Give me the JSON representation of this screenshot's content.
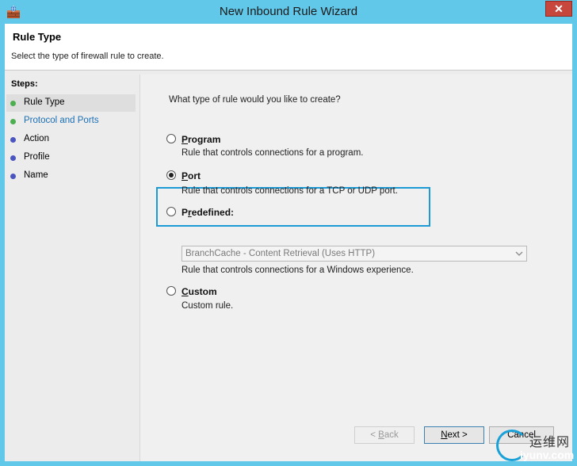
{
  "window": {
    "title": "New Inbound Rule Wizard",
    "close_glyph": "✕"
  },
  "header": {
    "title": "Rule Type",
    "description": "Select the type of firewall rule to create."
  },
  "steps": {
    "label": "Steps:",
    "items": [
      {
        "label": "Rule Type",
        "color": "#4caf50",
        "current": true
      },
      {
        "label": "Protocol and Ports",
        "color": "#4caf50",
        "link": true
      },
      {
        "label": "Action",
        "color": "#4a55c0"
      },
      {
        "label": "Profile",
        "color": "#4a55c0"
      },
      {
        "label": "Name",
        "color": "#4a55c0"
      }
    ]
  },
  "content": {
    "question": "What type of rule would you like to create?",
    "options": {
      "program": {
        "label_u": "P",
        "label_rest": "rogram",
        "desc": "Rule that controls connections for a program.",
        "checked": false
      },
      "port": {
        "label_u": "P",
        "label_rest": "ort",
        "desc": "Rule that controls connections for a TCP or UDP port.",
        "checked": true
      },
      "predefined": {
        "label_pre": "P",
        "label_u": "r",
        "label_rest": "edefined:",
        "desc": "Rule that controls connections for a Windows experience.",
        "checked": false,
        "select_value": "BranchCache - Content Retrieval (Uses HTTP)"
      },
      "custom": {
        "label_u": "C",
        "label_rest": "ustom",
        "desc": "Custom rule.",
        "checked": false
      }
    }
  },
  "buttons": {
    "back": {
      "pre": "< ",
      "u": "B",
      "rest": "ack"
    },
    "next": {
      "u": "N",
      "rest": "ext >"
    },
    "cancel": "Cancel"
  },
  "watermark": {
    "cn": "运维网",
    "url": "iyunv.com"
  },
  "colors": {
    "accent": "#1b9ad6",
    "titlebar": "#62c8ea",
    "close": "#c7473d"
  }
}
